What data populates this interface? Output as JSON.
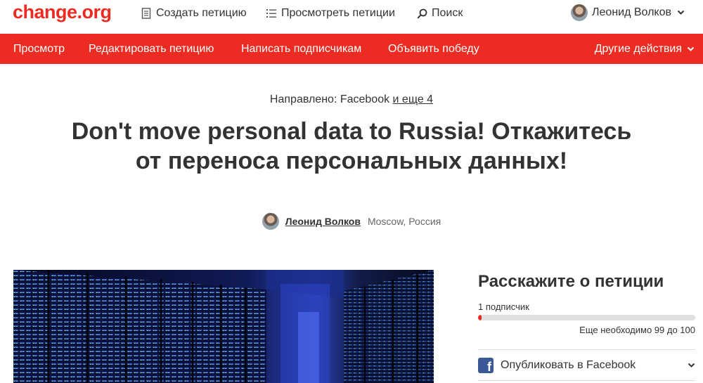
{
  "header": {
    "logo": "change.org",
    "nav": [
      {
        "label": "Создать петицию",
        "icon": "document-icon"
      },
      {
        "label": "Просмотреть петиции",
        "icon": "list-icon"
      },
      {
        "label": "Поиск",
        "icon": "search-icon"
      }
    ],
    "user_name": "Леонид Волков"
  },
  "actionbar": {
    "items": [
      "Просмотр",
      "Редактировать петицию",
      "Написать подписчикам",
      "Объявить победу"
    ],
    "other": "Другие действия"
  },
  "petition": {
    "directed_prefix": "Направлено: Facebook",
    "directed_more": "и еще 4",
    "title": "Don't move personal data to Russia! Откажитесь от переноса персональных данных!",
    "author": "Леонид Волков",
    "location": "Moscow, Россия"
  },
  "sidebar": {
    "title": "Расскажите о петиции",
    "supporters": "1 подписчик",
    "progress_fraction": 0.01,
    "remaining": "Еще необходимо 99 до 100",
    "share_facebook": "Опубликовать в Facebook"
  },
  "colors": {
    "brand": "#ec2c22",
    "facebook": "#3b5998"
  }
}
